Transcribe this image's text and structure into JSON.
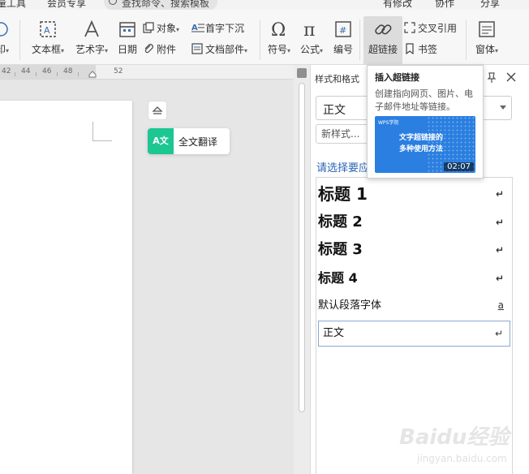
{
  "menubar": {
    "items": [
      "量工具",
      "会员专享"
    ],
    "search_text": "查找命令、搜索模板",
    "right_items": [
      "有修改",
      "协作",
      "分享"
    ]
  },
  "ribbon": {
    "tools": {
      "print": "印",
      "textbox": "文本框",
      "wordart": "艺术字",
      "date": "日期",
      "object": "对象",
      "attachment": "附件",
      "dropcap": "首字下沉",
      "docparts": "文档部件",
      "symbol": "符号",
      "formula": "公式",
      "numbering": "编号",
      "hyperlink": "超链接",
      "crossref": "交叉引用",
      "bookmark": "书签",
      "window": "窗体"
    }
  },
  "ruler": {
    "numbers": [
      "42",
      "44",
      "46",
      "48",
      "52"
    ]
  },
  "document": {
    "translate_label": "全文翻译",
    "translate_badge": "A文"
  },
  "panel": {
    "title": "样式和格式",
    "current_style": "正文",
    "new_style": "新样式...",
    "choose_label": "请选择要应",
    "styles": [
      {
        "label": "标题  1",
        "mark": "↵"
      },
      {
        "label": "标题  2",
        "mark": "↵"
      },
      {
        "label": "标题  3",
        "mark": "↵"
      },
      {
        "label": "标题  4",
        "mark": "↵"
      },
      {
        "label": "默认段落字体",
        "mark": "a"
      },
      {
        "label": "正文",
        "mark": "↵"
      }
    ]
  },
  "tooltip": {
    "title": "插入超链接",
    "desc": "创建指向网页、图片、电子邮件地址等链接。",
    "video_brand": "WPS学院",
    "video_title_1": "文字超链接的",
    "video_title_2": "多种使用方法",
    "duration": "02:07"
  },
  "watermark": {
    "main": "Baidu经验",
    "sub": "jingyan.baidu.com"
  },
  "colors": {
    "accent_blue": "#2a64b8",
    "translate_green": "#1dc791",
    "video_blue": "#2b7fe0"
  }
}
